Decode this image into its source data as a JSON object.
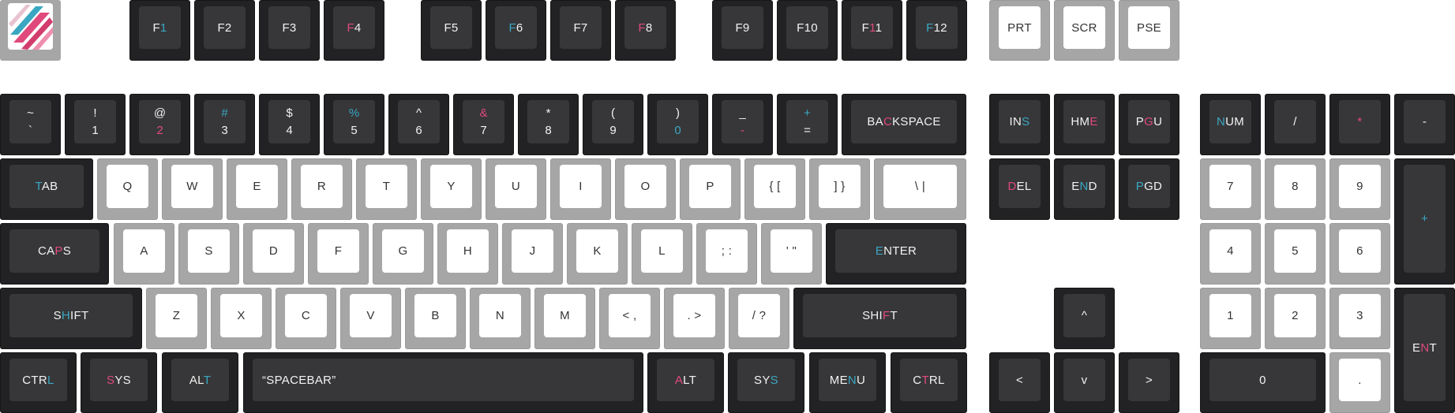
{
  "colors": {
    "pink": "#e0497b",
    "teal": "#3aa7c2",
    "dark": "#222224",
    "light": "#a6a6a6"
  },
  "logo_icon": "diagonal-stripes-logo",
  "rows": {
    "function": [
      {
        "id": "f1",
        "parts": [
          {
            "t": "F"
          },
          {
            "t": "1",
            "c": "teal"
          }
        ]
      },
      {
        "id": "f2",
        "parts": [
          {
            "t": "F2"
          }
        ]
      },
      {
        "id": "f3",
        "parts": [
          {
            "t": "F3"
          }
        ]
      },
      {
        "id": "f4",
        "parts": [
          {
            "t": "F",
            "c": "pink"
          },
          {
            "t": "4"
          }
        ]
      },
      {
        "id": "f5",
        "parts": [
          {
            "t": "F5"
          }
        ]
      },
      {
        "id": "f6",
        "parts": [
          {
            "t": "F",
            "c": "teal"
          },
          {
            "t": "6"
          }
        ]
      },
      {
        "id": "f7",
        "parts": [
          {
            "t": "F7"
          }
        ]
      },
      {
        "id": "f8",
        "parts": [
          {
            "t": "F",
            "c": "pink"
          },
          {
            "t": "8"
          }
        ]
      },
      {
        "id": "f9",
        "parts": [
          {
            "t": "F9"
          }
        ]
      },
      {
        "id": "f10",
        "parts": [
          {
            "t": "F10"
          }
        ]
      },
      {
        "id": "f11",
        "parts": [
          {
            "t": "F"
          },
          {
            "t": "1",
            "c": "pink"
          },
          {
            "t": "1"
          }
        ]
      },
      {
        "id": "f12",
        "parts": [
          {
            "t": "F",
            "c": "teal"
          },
          {
            "t": "12"
          }
        ]
      },
      {
        "id": "prt",
        "parts": [
          {
            "t": "PRT"
          }
        ]
      },
      {
        "id": "scr",
        "parts": [
          {
            "t": "SCR"
          }
        ]
      },
      {
        "id": "pse",
        "parts": [
          {
            "t": "PSE"
          }
        ]
      }
    ],
    "number": [
      {
        "id": "tilde",
        "top": "~",
        "bottom": "`"
      },
      {
        "id": "1",
        "top": "!",
        "bottom": "1"
      },
      {
        "id": "2",
        "top": "@",
        "bottom": "2",
        "bc": "pink"
      },
      {
        "id": "3",
        "top": "#",
        "bottom": "3",
        "tc": "teal"
      },
      {
        "id": "4",
        "top": "$",
        "bottom": "4"
      },
      {
        "id": "5",
        "top": "%",
        "bottom": "5",
        "tc": "teal"
      },
      {
        "id": "6",
        "top": "^",
        "bottom": "6"
      },
      {
        "id": "7",
        "top": "&",
        "bottom": "7",
        "tc": "pink"
      },
      {
        "id": "8",
        "top": "*",
        "bottom": "8"
      },
      {
        "id": "9",
        "top": "(",
        "bottom": "9"
      },
      {
        "id": "0",
        "top": ")",
        "bottom": "0",
        "bc": "teal"
      },
      {
        "id": "minus",
        "top": "_",
        "bottom": "-",
        "bc": "pink"
      },
      {
        "id": "equals",
        "top": "+",
        "bottom": "=",
        "tc": "teal"
      },
      {
        "id": "backspace",
        "parts": [
          {
            "t": "BA"
          },
          {
            "t": "C",
            "c": "pink"
          },
          {
            "t": "KSPACE"
          }
        ]
      },
      {
        "id": "ins",
        "parts": [
          {
            "t": "IN"
          },
          {
            "t": "S",
            "c": "teal"
          }
        ]
      },
      {
        "id": "hme",
        "parts": [
          {
            "t": "HM"
          },
          {
            "t": "E",
            "c": "pink"
          }
        ]
      },
      {
        "id": "pgu",
        "parts": [
          {
            "t": "P"
          },
          {
            "t": "G",
            "c": "pink"
          },
          {
            "t": "U"
          }
        ]
      },
      {
        "id": "num",
        "parts": [
          {
            "t": "N",
            "c": "teal"
          },
          {
            "t": "UM"
          }
        ]
      },
      {
        "id": "kp-slash",
        "parts": [
          {
            "t": "/"
          }
        ]
      },
      {
        "id": "kp-star",
        "parts": [
          {
            "t": "*",
            "c": "pink"
          }
        ]
      },
      {
        "id": "kp-minus",
        "parts": [
          {
            "t": "-"
          }
        ]
      }
    ],
    "top": [
      {
        "id": "tab",
        "parts": [
          {
            "t": "T",
            "c": "teal"
          },
          {
            "t": "AB"
          }
        ]
      },
      {
        "id": "q",
        "parts": [
          {
            "t": "Q"
          }
        ]
      },
      {
        "id": "w",
        "parts": [
          {
            "t": "W"
          }
        ]
      },
      {
        "id": "e",
        "parts": [
          {
            "t": "E"
          }
        ]
      },
      {
        "id": "r",
        "parts": [
          {
            "t": "R"
          }
        ]
      },
      {
        "id": "t",
        "parts": [
          {
            "t": "T"
          }
        ]
      },
      {
        "id": "y",
        "parts": [
          {
            "t": "Y"
          }
        ]
      },
      {
        "id": "u",
        "parts": [
          {
            "t": "U"
          }
        ]
      },
      {
        "id": "i",
        "parts": [
          {
            "t": "I"
          }
        ]
      },
      {
        "id": "o",
        "parts": [
          {
            "t": "O"
          }
        ]
      },
      {
        "id": "p",
        "parts": [
          {
            "t": "P"
          }
        ]
      },
      {
        "id": "lbracket",
        "parts": [
          {
            "t": "{ ["
          }
        ]
      },
      {
        "id": "rbracket",
        "parts": [
          {
            "t": "] }"
          }
        ]
      },
      {
        "id": "backslash",
        "parts": [
          {
            "t": "\\ |"
          }
        ]
      },
      {
        "id": "del",
        "parts": [
          {
            "t": "D",
            "c": "pink"
          },
          {
            "t": "EL"
          }
        ]
      },
      {
        "id": "end",
        "parts": [
          {
            "t": "E"
          },
          {
            "t": "N",
            "c": "teal"
          },
          {
            "t": "D"
          }
        ]
      },
      {
        "id": "pgd",
        "parts": [
          {
            "t": "P",
            "c": "teal"
          },
          {
            "t": "GD"
          }
        ]
      },
      {
        "id": "kp-7",
        "parts": [
          {
            "t": "7"
          }
        ]
      },
      {
        "id": "kp-8",
        "parts": [
          {
            "t": "8"
          }
        ]
      },
      {
        "id": "kp-9",
        "parts": [
          {
            "t": "9"
          }
        ]
      },
      {
        "id": "kp-plus",
        "parts": [
          {
            "t": "+",
            "c": "teal"
          }
        ]
      }
    ],
    "home": [
      {
        "id": "caps",
        "parts": [
          {
            "t": "CA"
          },
          {
            "t": "P",
            "c": "pink"
          },
          {
            "t": "S"
          }
        ]
      },
      {
        "id": "a",
        "parts": [
          {
            "t": "A"
          }
        ]
      },
      {
        "id": "s",
        "parts": [
          {
            "t": "S"
          }
        ]
      },
      {
        "id": "d",
        "parts": [
          {
            "t": "D"
          }
        ]
      },
      {
        "id": "f",
        "parts": [
          {
            "t": "F"
          }
        ]
      },
      {
        "id": "g",
        "parts": [
          {
            "t": "G"
          }
        ]
      },
      {
        "id": "h",
        "parts": [
          {
            "t": "H"
          }
        ]
      },
      {
        "id": "j",
        "parts": [
          {
            "t": "J"
          }
        ]
      },
      {
        "id": "k",
        "parts": [
          {
            "t": "K"
          }
        ]
      },
      {
        "id": "l",
        "parts": [
          {
            "t": "L"
          }
        ]
      },
      {
        "id": "semicolon",
        "parts": [
          {
            "t": "; :"
          }
        ]
      },
      {
        "id": "quote",
        "parts": [
          {
            "t": "' \""
          }
        ]
      },
      {
        "id": "enter",
        "parts": [
          {
            "t": "E",
            "c": "teal"
          },
          {
            "t": "NTER"
          }
        ]
      },
      {
        "id": "kp-4",
        "parts": [
          {
            "t": "4"
          }
        ]
      },
      {
        "id": "kp-5",
        "parts": [
          {
            "t": "5"
          }
        ]
      },
      {
        "id": "kp-6",
        "parts": [
          {
            "t": "6"
          }
        ]
      }
    ],
    "bottom": [
      {
        "id": "lshift",
        "parts": [
          {
            "t": "S"
          },
          {
            "t": "H",
            "c": "teal"
          },
          {
            "t": "IFT"
          }
        ]
      },
      {
        "id": "z",
        "parts": [
          {
            "t": "Z"
          }
        ]
      },
      {
        "id": "x",
        "parts": [
          {
            "t": "X"
          }
        ]
      },
      {
        "id": "c",
        "parts": [
          {
            "t": "C"
          }
        ]
      },
      {
        "id": "v",
        "parts": [
          {
            "t": "V"
          }
        ]
      },
      {
        "id": "b",
        "parts": [
          {
            "t": "B"
          }
        ]
      },
      {
        "id": "n",
        "parts": [
          {
            "t": "N"
          }
        ]
      },
      {
        "id": "m",
        "parts": [
          {
            "t": "M"
          }
        ]
      },
      {
        "id": "comma",
        "parts": [
          {
            "t": "< ,"
          }
        ]
      },
      {
        "id": "period",
        "parts": [
          {
            "t": ". >"
          }
        ]
      },
      {
        "id": "slash",
        "parts": [
          {
            "t": "/ ?"
          }
        ]
      },
      {
        "id": "rshift",
        "parts": [
          {
            "t": "SHI"
          },
          {
            "t": "F",
            "c": "pink"
          },
          {
            "t": "T"
          }
        ]
      },
      {
        "id": "up",
        "parts": [
          {
            "t": "^"
          }
        ]
      },
      {
        "id": "kp-1",
        "parts": [
          {
            "t": "1"
          }
        ]
      },
      {
        "id": "kp-2",
        "parts": [
          {
            "t": "2"
          }
        ]
      },
      {
        "id": "kp-3",
        "parts": [
          {
            "t": "3"
          }
        ]
      },
      {
        "id": "kp-enter",
        "parts": [
          {
            "t": "E"
          },
          {
            "t": "N",
            "c": "pink"
          },
          {
            "t": "T"
          }
        ]
      }
    ],
    "space": [
      {
        "id": "lctrl",
        "parts": [
          {
            "t": "CTR"
          },
          {
            "t": "L",
            "c": "teal"
          }
        ]
      },
      {
        "id": "lsys",
        "parts": [
          {
            "t": "S",
            "c": "pink"
          },
          {
            "t": "YS"
          }
        ]
      },
      {
        "id": "lalt",
        "parts": [
          {
            "t": "AL"
          },
          {
            "t": "T",
            "c": "teal"
          }
        ]
      },
      {
        "id": "spacebar",
        "parts": [
          {
            "t": "“SPACEBAR”"
          }
        ]
      },
      {
        "id": "ralt",
        "parts": [
          {
            "t": "A",
            "c": "pink"
          },
          {
            "t": "LT"
          }
        ]
      },
      {
        "id": "rsys",
        "parts": [
          {
            "t": "SY"
          },
          {
            "t": "S",
            "c": "teal"
          }
        ]
      },
      {
        "id": "menu",
        "parts": [
          {
            "t": "ME"
          },
          {
            "t": "N",
            "c": "teal"
          },
          {
            "t": "U"
          }
        ]
      },
      {
        "id": "rctrl",
        "parts": [
          {
            "t": "C"
          },
          {
            "t": "T",
            "c": "pink"
          },
          {
            "t": "RL"
          }
        ]
      },
      {
        "id": "left",
        "parts": [
          {
            "t": "<"
          }
        ]
      },
      {
        "id": "down",
        "parts": [
          {
            "t": "v"
          }
        ]
      },
      {
        "id": "right",
        "parts": [
          {
            "t": ">"
          }
        ]
      },
      {
        "id": "kp-0",
        "parts": [
          {
            "t": "0"
          }
        ]
      },
      {
        "id": "kp-dot",
        "parts": [
          {
            "t": "."
          }
        ]
      }
    ]
  }
}
